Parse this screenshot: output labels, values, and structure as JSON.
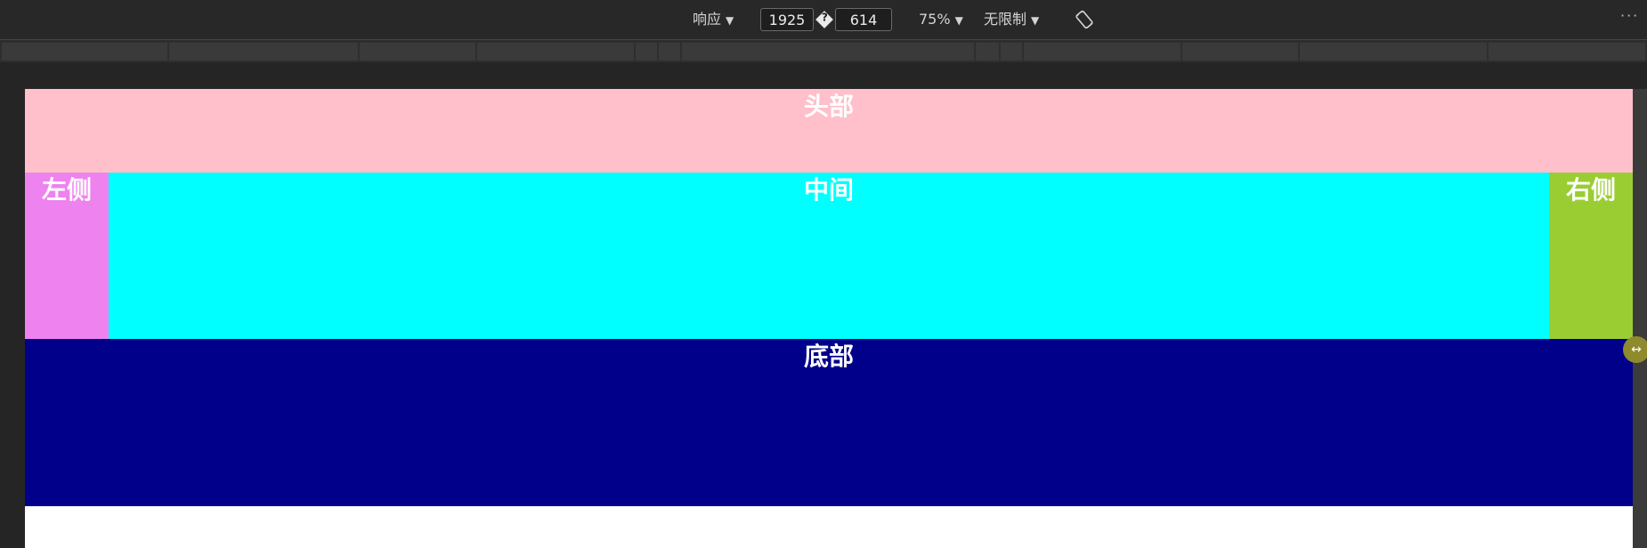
{
  "toolbar": {
    "device_mode": "响应",
    "width_value": "1925",
    "swap_glyph": "?",
    "height_value": "614",
    "zoom": "75%",
    "throttle": "无限制",
    "more": "···"
  },
  "icons": {
    "dropdown": "chevron-down-icon",
    "rotate": "rotate-icon",
    "swap": "swap-dimensions-icon",
    "resize": "resize-handle-icon"
  },
  "page": {
    "header": "头部",
    "left": "左侧",
    "center": "中间",
    "right": "右侧",
    "footer": "底部"
  },
  "colors": {
    "header": "#ffc0cb",
    "left": "#ee82ee",
    "center": "#00ffff",
    "right": "#9acd32",
    "footer": "#00008b"
  }
}
